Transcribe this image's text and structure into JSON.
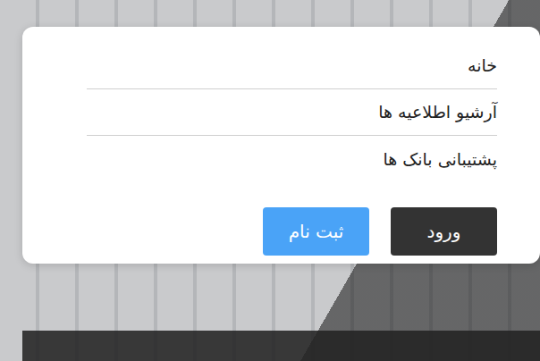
{
  "menu": {
    "items": [
      {
        "label": "خانه"
      },
      {
        "label": "آرشیو اطلاعیه ها"
      },
      {
        "label": "پشتیبانی بانک ها"
      }
    ]
  },
  "buttons": [
    {
      "label": "ورود",
      "kind": "dark"
    },
    {
      "label": "ثبت نام",
      "kind": "primary"
    }
  ]
}
